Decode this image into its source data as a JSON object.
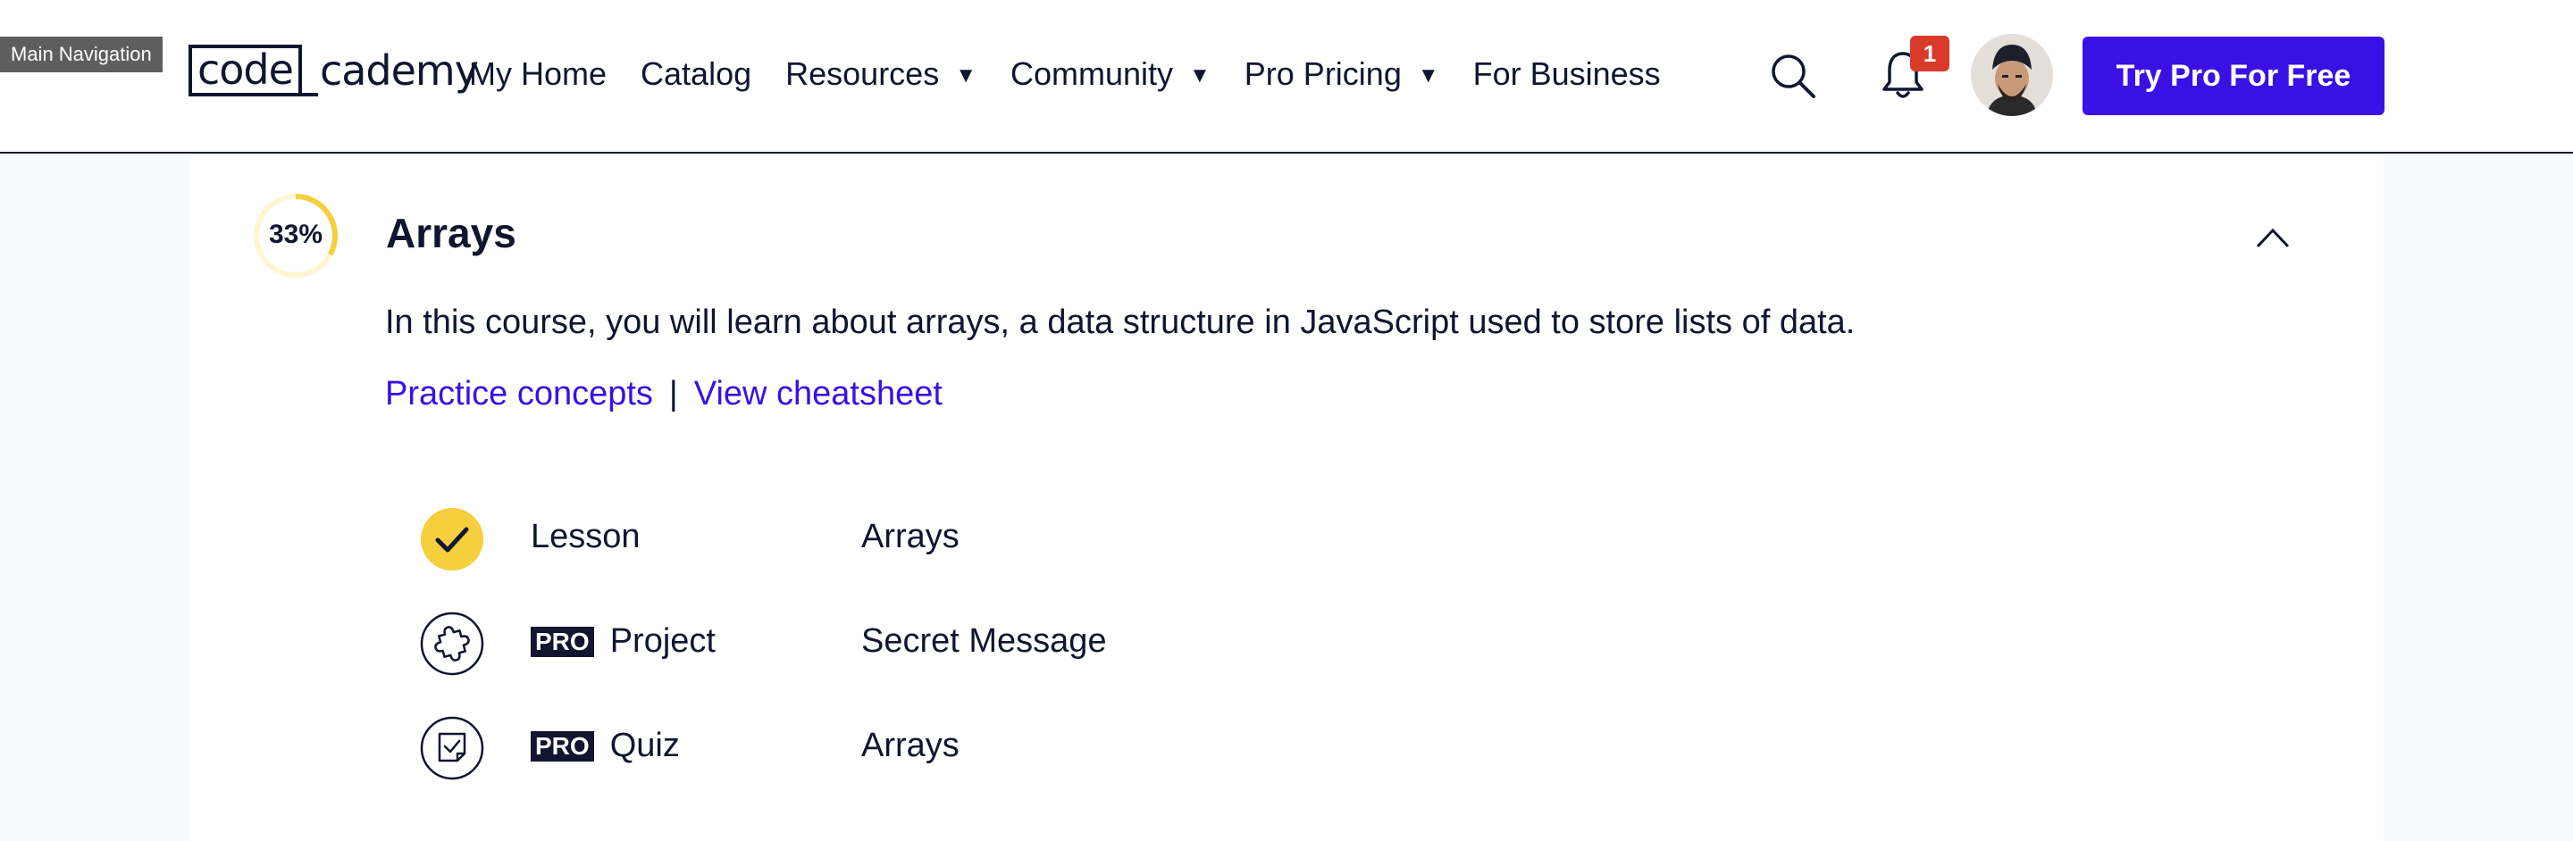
{
  "tooltip": "Main Navigation",
  "logo": {
    "part1": "code",
    "part2": "cademy"
  },
  "nav": {
    "items": [
      {
        "label": "My Home",
        "dropdown": false
      },
      {
        "label": "Catalog",
        "dropdown": false
      },
      {
        "label": "Resources",
        "dropdown": true
      },
      {
        "label": "Community",
        "dropdown": true
      },
      {
        "label": "Pro Pricing",
        "dropdown": true
      },
      {
        "label": "For Business",
        "dropdown": false
      }
    ],
    "caret": "▼",
    "notification_count": "1",
    "cta_label": "Try Pro For Free"
  },
  "module": {
    "progress_label": "33%",
    "progress_fraction": 0.33,
    "title": "Arrays",
    "description": "In this course, you will learn about arrays, a data structure in JavaScript used to store lists of data.",
    "links": {
      "practice": "Practice concepts",
      "separator": "|",
      "cheatsheet": "View cheatsheet"
    },
    "items": [
      {
        "status_icon": "check-icon",
        "pro": false,
        "type": "Lesson",
        "name": "Arrays"
      },
      {
        "status_icon": "puzzle-icon",
        "pro": true,
        "type": "Project",
        "name": "Secret Message"
      },
      {
        "status_icon": "quiz-icon",
        "pro": true,
        "type": "Quiz",
        "name": "Arrays"
      }
    ],
    "pro_badge": "PRO"
  },
  "colors": {
    "brand_primary": "#3a10e5",
    "text_dark": "#10162f",
    "progress_yellow": "#ffd300",
    "notification_red": "#da3a29",
    "page_background": "#f5fcff"
  }
}
